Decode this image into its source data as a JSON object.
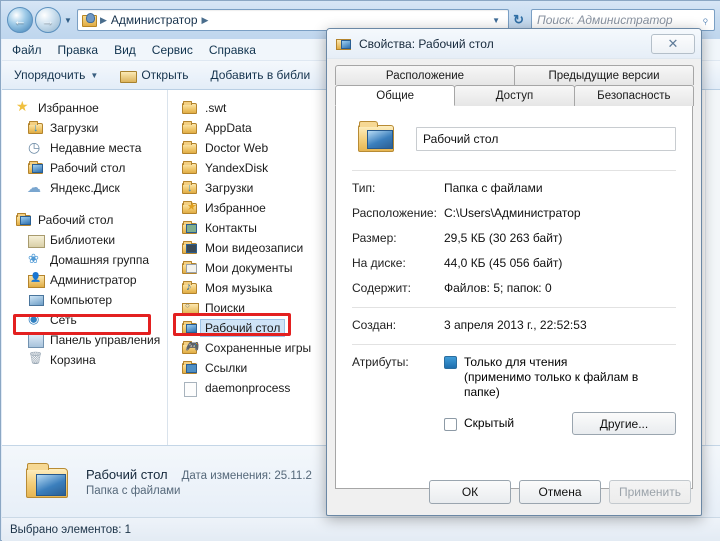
{
  "explorer": {
    "address": {
      "back_icon": "back-arrow-icon",
      "forward_icon": "forward-arrow-icon",
      "history_icon": "chevron-down-icon",
      "folder_icon": "user-folder-icon",
      "crumb": "Администратор",
      "separator": "▸",
      "dropdown_icon": "chevron-down-icon",
      "refresh_icon": "refresh-icon"
    },
    "search": {
      "placeholder": "Поиск: Администратор",
      "icon": "search-icon"
    },
    "menu": [
      "Файл",
      "Правка",
      "Вид",
      "Сервис",
      "Справка"
    ],
    "toolbar": {
      "organize": "Упорядочить",
      "caret": "▾",
      "open": "Открыть",
      "add_to_library": "Добавить в библи"
    },
    "nav_tree": [
      {
        "label": "Избранное",
        "icon": "star-icon",
        "indent": false
      },
      {
        "label": "Загрузки",
        "icon": "downloads-folder-icon",
        "indent": true
      },
      {
        "label": "Недавние места",
        "icon": "recent-places-icon",
        "indent": true
      },
      {
        "label": "Рабочий стол",
        "icon": "desktop-folder-icon",
        "indent": true
      },
      {
        "label": "Яндекс.Диск",
        "icon": "yandex-disk-icon",
        "indent": true
      },
      {
        "label": "Рабочий стол",
        "icon": "desktop-folder-icon",
        "indent": false
      },
      {
        "label": "Библиотеки",
        "icon": "libraries-icon",
        "indent": false
      },
      {
        "label": "Домашняя группа",
        "icon": "homegroup-icon",
        "indent": false
      },
      {
        "label": "Администратор",
        "icon": "user-folder-icon",
        "indent": false
      },
      {
        "label": "Компьютер",
        "icon": "computer-icon",
        "indent": false
      },
      {
        "label": "Сеть",
        "icon": "network-icon",
        "indent": false
      },
      {
        "label": "Панель управления",
        "icon": "control-panel-icon",
        "indent": false
      },
      {
        "label": "Корзина",
        "icon": "recycle-bin-icon",
        "indent": false
      }
    ],
    "files": [
      {
        "label": ".swt",
        "icon": "folder-icon",
        "selected": false
      },
      {
        "label": "AppData",
        "icon": "folder-icon",
        "selected": false
      },
      {
        "label": "Doctor Web",
        "icon": "folder-icon",
        "selected": false
      },
      {
        "label": "YandexDisk",
        "icon": "folder-icon",
        "selected": false
      },
      {
        "label": "Загрузки",
        "icon": "downloads-folder-icon",
        "selected": false
      },
      {
        "label": "Избранное",
        "icon": "favorites-folder-icon",
        "selected": false
      },
      {
        "label": "Контакты",
        "icon": "contacts-folder-icon",
        "selected": false
      },
      {
        "label": "Мои видеозаписи",
        "icon": "videos-folder-icon",
        "selected": false
      },
      {
        "label": "Мои документы",
        "icon": "documents-folder-icon",
        "selected": false
      },
      {
        "label": "Моя музыка",
        "icon": "music-folder-icon",
        "selected": false
      },
      {
        "label": "Поиски",
        "icon": "searches-folder-icon",
        "selected": false
      },
      {
        "label": "Рабочий стол",
        "icon": "desktop-folder-icon",
        "selected": true
      },
      {
        "label": "Сохраненные игры",
        "icon": "saved-games-folder-icon",
        "selected": false
      },
      {
        "label": "Ссылки",
        "icon": "links-folder-icon",
        "selected": false
      },
      {
        "label": "daemonprocess",
        "icon": "file-icon",
        "selected": false
      }
    ],
    "details": {
      "name": "Рабочий стол",
      "modified_label": "Дата изменения: 25.11.2",
      "type": "Папка с файлами",
      "icon": "desktop-folder-icon"
    },
    "status": "Выбрано элементов: 1"
  },
  "dialog": {
    "title": "Свойства: Рабочий стол",
    "title_icon": "desktop-folder-icon",
    "close_icon": "close-icon",
    "tabs_top": [
      "Расположение",
      "Предыдущие версии"
    ],
    "tabs_bottom": [
      "Общие",
      "Доступ",
      "Безопасность"
    ],
    "active_tab": "Общие",
    "name_value": "Рабочий стол",
    "fields": [
      {
        "label": "Тип:",
        "value": "Папка с файлами"
      },
      {
        "label": "Расположение:",
        "value": "C:\\Users\\Администратор"
      },
      {
        "label": "Размер:",
        "value": "29,5 КБ (30 263 байт)"
      },
      {
        "label": "На диске:",
        "value": "44,0 КБ (45 056 байт)"
      },
      {
        "label": "Содержит:",
        "value": "Файлов: 5; папок: 0"
      },
      {
        "label": "Создан:",
        "value": "3 апреля 2013 г., 22:52:53"
      }
    ],
    "attributes_label": "Атрибуты:",
    "readonly_label": "Только для чтения",
    "readonly_note": "(применимо только к файлам в папке)",
    "readonly_state": "indeterminate",
    "hidden_label": "Скрытый",
    "hidden_state": "unchecked",
    "other_button": "Другие...",
    "buttons": {
      "ok": "ОК",
      "cancel": "Отмена",
      "apply": "Применить"
    }
  },
  "annotations": {
    "accent_color": "#e32020",
    "boxes": [
      "sidebar-administrator",
      "file-desktop",
      "size-fields"
    ]
  }
}
